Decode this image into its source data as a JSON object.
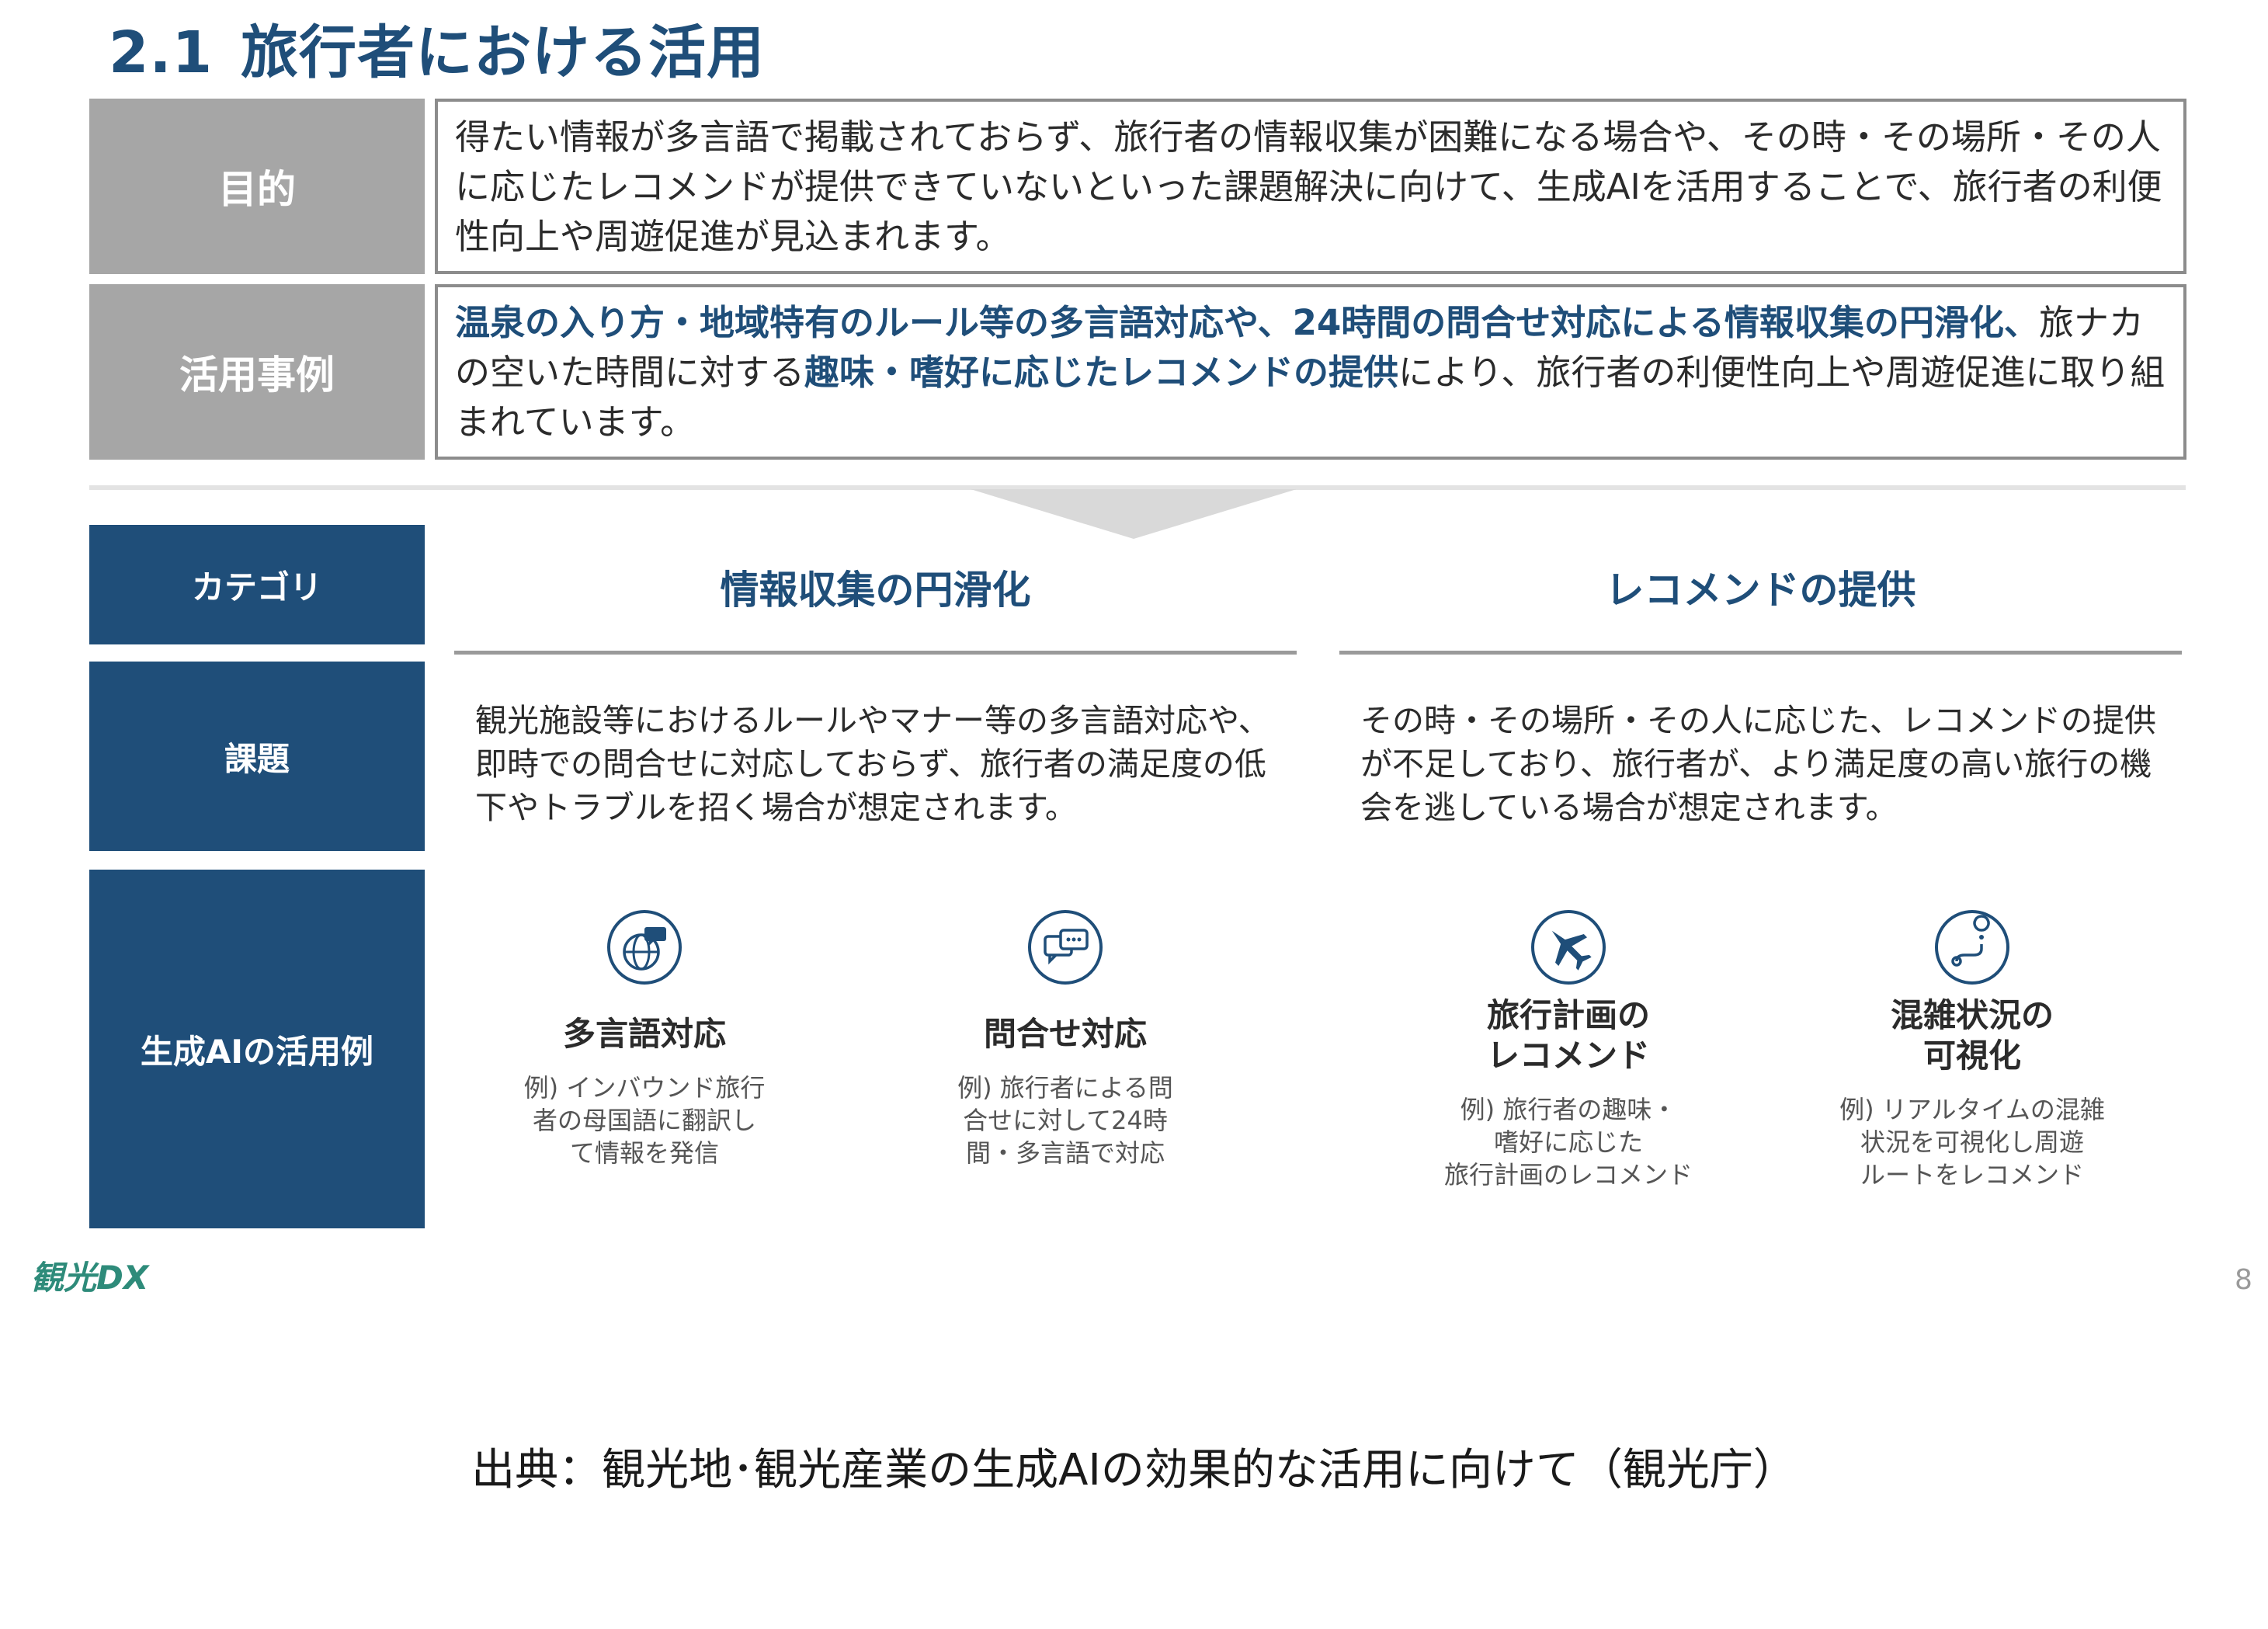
{
  "title": {
    "number": "2.1",
    "text": "旅行者における活用"
  },
  "purpose": {
    "label": "目的",
    "text": "得たい情報が多言語で掲載されておらず、旅行者の情報収集が困難になる場合や、その時・その場所・その人に応じたレコメンドが提供できていないといった課題解決に向けて、生成AIを活用することで、旅行者の利便性向上や周遊促進が見込まれます。"
  },
  "examples": {
    "label": "活用事例",
    "hl1": "温泉の入り方・地域特有のルール等の多言語対応や、24時間の問合せ対応による情報収集の円滑化、",
    "plain1": "旅ナカの空いた時間に対する",
    "hl2": "趣味・嗜好に応じたレコメンドの提供",
    "plain2": "により、旅行者の利便性向上や周遊促進に取り組まれています。"
  },
  "rows": {
    "category": "カテゴリ",
    "issue": "課題",
    "genai": "生成AIの活用例"
  },
  "columns": [
    {
      "title": "情報収集の円滑化",
      "issue": "観光施設等におけるルールやマナー等の多言語対応や、即時での問合せに対応しておらず、旅行者の満足度の低下やトラブルを招く場合が想定されます。"
    },
    {
      "title": "レコメンドの提供",
      "issue": "その時・その場所・その人に応じた、レコメンドの提供が不足しており、旅行者が、より満足度の高い旅行の機会を逃している場合が想定されます。"
    }
  ],
  "usecases": [
    {
      "icon": "globe-icon",
      "title_1": "多言語対応",
      "title_2": "",
      "desc_1": "例) インバウンド旅行",
      "desc_2": "者の母国語に翻訳し",
      "desc_3": "て情報を発信"
    },
    {
      "icon": "chat-icon",
      "title_1": "問合せ対応",
      "title_2": "",
      "desc_1": "例) 旅行者による問",
      "desc_2": "合せに対して24時",
      "desc_3": "間・多言語で対応"
    },
    {
      "icon": "airplane-icon",
      "title_1": "旅行計画の",
      "title_2": "レコメンド",
      "desc_1": "例) 旅行者の趣味・",
      "desc_2": "嗜好に応じた",
      "desc_3": "旅行計画のレコメンド"
    },
    {
      "icon": "route-icon",
      "title_1": "混雑状況の",
      "title_2": "可視化",
      "desc_1": "例) リアルタイムの混雑",
      "desc_2": "状況を可視化し周遊",
      "desc_3": "ルートをレコメンド"
    }
  ],
  "footer": {
    "logo": "観光DX",
    "page": "8"
  },
  "source": "出典：観光地･観光産業の生成AIの効果的な活用に向けて（観光庁）",
  "colors": {
    "navy": "#1f4e79",
    "gray": "#a6a6a6",
    "border": "#8c8c8c"
  }
}
